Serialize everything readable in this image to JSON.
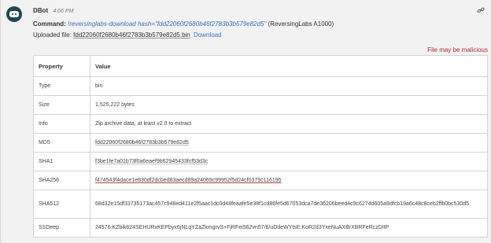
{
  "message": {
    "sender": "DBot",
    "time": "4:06 PM",
    "command_label": "Command:",
    "command": "!reversinglabs-download hash=\"fdd22060f2680b46f2783b3b579e82d5\"",
    "command_suffix": "(ReversingLabs A1000)",
    "uploaded_label": "Uploaded file:",
    "uploaded_file": "fdd22060f2680b46f2783b3b579e82d5.bin",
    "download_label": "Download",
    "warning": "File may be malicious"
  },
  "table": {
    "headers": [
      "Property",
      "Value"
    ],
    "rows": [
      {
        "key": "Type",
        "value": "bin"
      },
      {
        "key": "Size",
        "value": "1,525,222 bytes"
      },
      {
        "key": "Info",
        "value": "Zip archive data, at least v2.0 to extract"
      },
      {
        "key": "MD5",
        "value": "fdd22060f2680b46f2783b3b579e82d5"
      },
      {
        "key": "SHA1",
        "value": "f3be1fe7a01b73f0a6eaef9b62945433fcf53d3c"
      },
      {
        "key": "SHA256",
        "value": "f474543f4dace1e830df2dcbed83aecd89a24069c99952f5d24cf0379c116195"
      },
      {
        "key": "SHA512",
        "value": "68d32e15df33735173ac457c948ed411e2f5aac1dc0d48feaafe5e38f1cd86fe5d67053dca7de36206beed4c9c6274d605a9dfcb19a6c48c8ceb2ffb0bc530d5"
      },
      {
        "key": "SSDeep",
        "value": "24576:KZbik824SEHURxKEPbyx6jNLqYZaZkmgrvS+FjRFei562vn57/6/uDdeWYtsE:KoR2d3YxeNuAXBrXBRFeRczDItP"
      }
    ]
  },
  "colors": {
    "avatar": "#1e4a52",
    "link": "#3a6fc4",
    "warning": "#b22a2a"
  },
  "icons": {
    "avatar": "bot-avatar-icon",
    "link": "link-icon"
  }
}
